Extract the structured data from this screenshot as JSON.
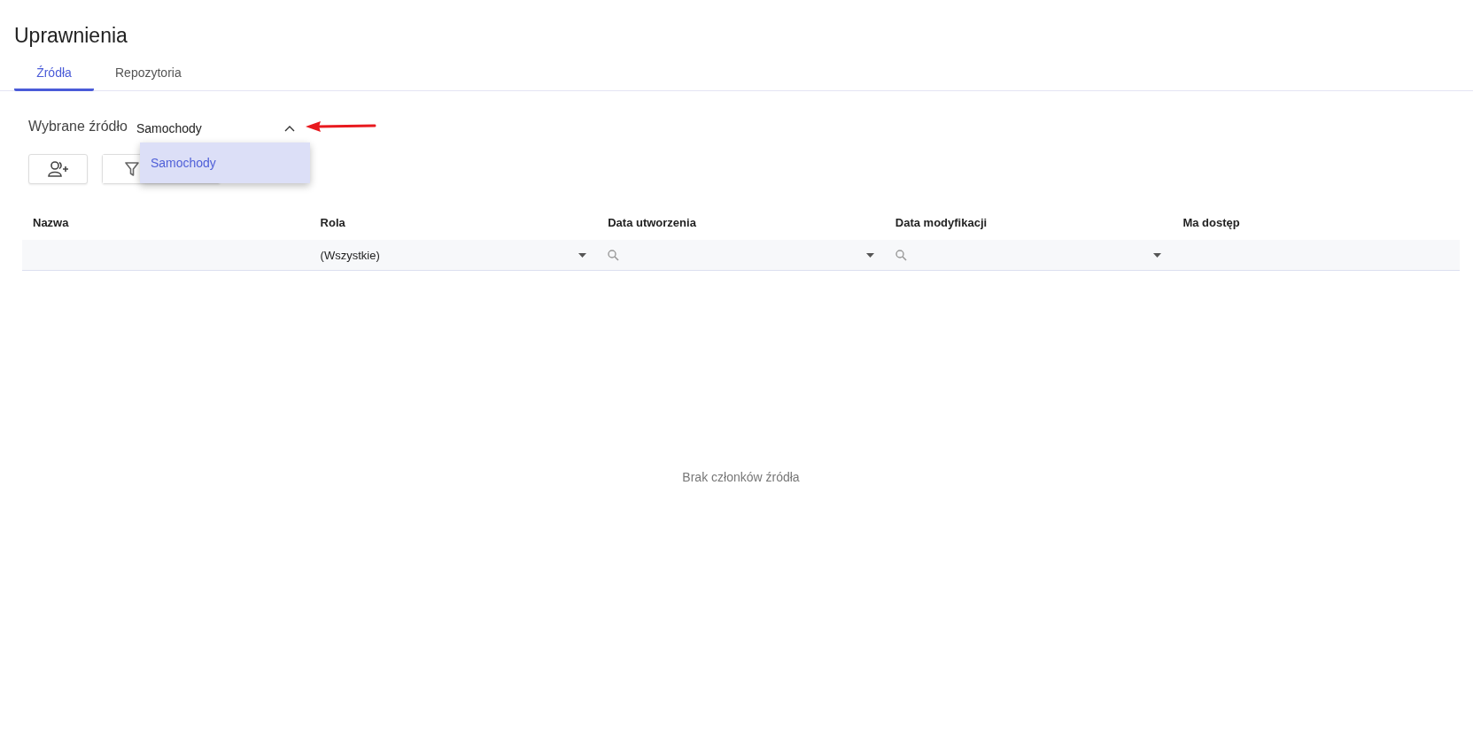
{
  "page": {
    "title": "Uprawnienia"
  },
  "tabs": [
    {
      "label": "Źródła",
      "selected": true
    },
    {
      "label": "Repozytoria",
      "selected": false
    }
  ],
  "source_selector": {
    "label": "Wybrane źródło",
    "value": "Samochody",
    "expanded": true,
    "options": [
      {
        "label": "Samochody",
        "selected": true
      }
    ]
  },
  "table": {
    "columns": [
      {
        "label": "Nazwa",
        "filter": {
          "kind": "none"
        }
      },
      {
        "label": "Rola",
        "filter": {
          "kind": "select",
          "value": "(Wszystkie)"
        }
      },
      {
        "label": "Data utworzenia",
        "filter": {
          "kind": "date"
        }
      },
      {
        "label": "Data modyfikacji",
        "filter": {
          "kind": "date"
        }
      },
      {
        "label": "Ma dostęp",
        "filter": {
          "kind": "none"
        }
      }
    ],
    "empty_message": "Brak członków źródła"
  }
}
